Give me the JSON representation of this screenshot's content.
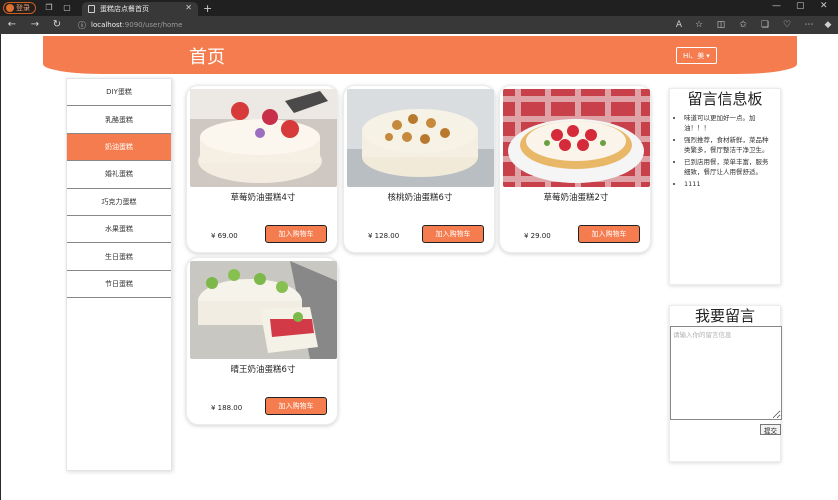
{
  "browser": {
    "profile_label": "登录",
    "tab_title": "蛋糕店点餐首页",
    "url_host": "localhost",
    "url_path": ":9090/user/home"
  },
  "header": {
    "title": "首页",
    "user_greeting": "Hi、美",
    "user_caret": "▾"
  },
  "sidebar": {
    "items": [
      {
        "label": "DIY蛋糕"
      },
      {
        "label": "乳酪蛋糕"
      },
      {
        "label": "奶油蛋糕",
        "active": true
      },
      {
        "label": "婚礼蛋糕"
      },
      {
        "label": "巧克力蛋糕"
      },
      {
        "label": "水果蛋糕"
      },
      {
        "label": "生日蛋糕"
      },
      {
        "label": "节日蛋糕"
      }
    ]
  },
  "products": [
    {
      "name": "草莓奶油蛋糕4寸",
      "price": "¥ 69.00",
      "button": "加入购物车"
    },
    {
      "name": "核桃奶油蛋糕6寸",
      "price": "¥ 128.00",
      "button": "加入购物车"
    },
    {
      "name": "草莓奶油蛋糕2寸",
      "price": "¥ 29.00",
      "button": "加入购物车"
    },
    {
      "name": "晴王奶油蛋糕6寸",
      "price": "¥ 188.00",
      "button": "加入购物车"
    }
  ],
  "message_board": {
    "title": "留言信息板",
    "messages": [
      "味道可以更加好一点。加油！！！",
      "强烈推荐，食材新鲜，菜品种类繁多，餐厅整洁干净卫生。",
      "已到店用餐，菜单丰富，服务细致，餐厅让人用餐舒适。",
      "1111"
    ]
  },
  "leave_message": {
    "title": "我要留言",
    "placeholder": "请输入你的留言信息",
    "submit_label": "提交"
  },
  "colors": {
    "accent": "#f47c4e",
    "chrome_dark": "#202020",
    "chrome_bar": "#383838"
  }
}
